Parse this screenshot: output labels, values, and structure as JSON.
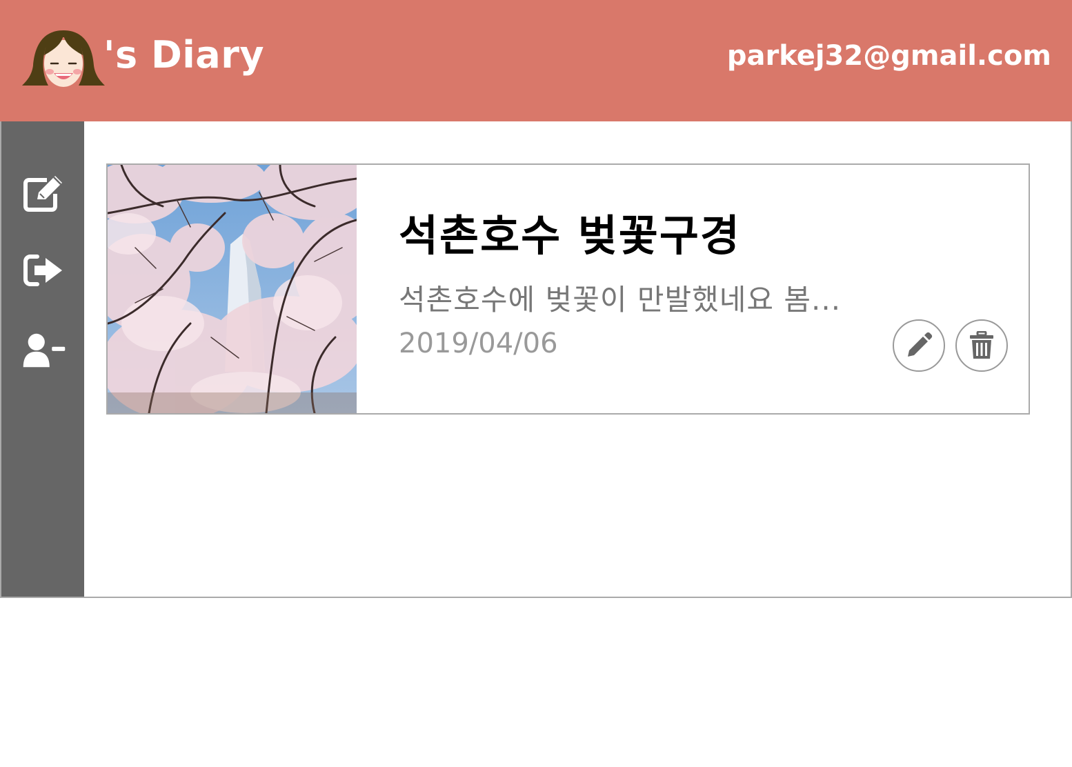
{
  "header": {
    "brand_title": "'s Diary",
    "user_email": "parkej32@gmail.com",
    "background_color": "#d9786a"
  },
  "sidebar": {
    "background_color": "#666666",
    "items": [
      {
        "icon": "write-icon"
      },
      {
        "icon": "sign-out-icon"
      },
      {
        "icon": "remove-user-icon"
      }
    ]
  },
  "entries": [
    {
      "title": "석촌호수 벚꽃구경",
      "excerpt": "석촌호수에 벚꽃이 만발했네요 봄...",
      "date": "2019/04/06",
      "actions": [
        {
          "icon": "pencil-icon"
        },
        {
          "icon": "trash-icon"
        }
      ]
    }
  ]
}
